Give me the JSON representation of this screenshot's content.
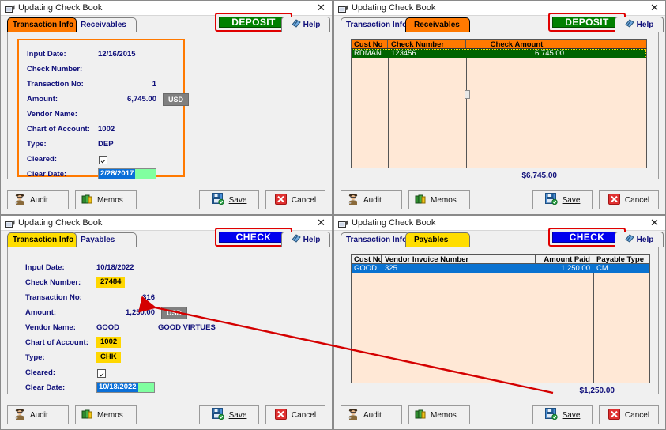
{
  "window_title": "Updating Check Book",
  "common": {
    "tab_transaction": "Transaction Info",
    "help_label": "Help",
    "audit_label": "Audit",
    "memos_label": "Memos",
    "save_label": "Save",
    "cancel_label": "Cancel",
    "close_glyph": "✕",
    "usd_chip": "USD"
  },
  "labels": {
    "input_date": "Input Date:",
    "check_number": "Check Number:",
    "transaction_no": "Transaction No:",
    "amount": "Amount:",
    "vendor_name": "Vendor Name:",
    "chart_of_account": "Chart of Account:",
    "type": "Type:",
    "cleared": "Cleared:",
    "clear_date": "Clear Date:"
  },
  "panels": {
    "top_left": {
      "tab_second": "Receivables",
      "active_tab": "Transaction Info",
      "action_button": "DEPOSIT",
      "action_color": "#008000",
      "form": {
        "input_date": "12/16/2015",
        "check_number": "",
        "transaction_no": "1",
        "amount": "6,745.00",
        "vendor_name": "",
        "chart_of_account": "1002",
        "type": "DEP",
        "cleared": true,
        "clear_date": "2/28/2017"
      }
    },
    "top_right": {
      "tab_second": "Receivables",
      "active_tab": "Receivables",
      "action_button": "DEPOSIT",
      "action_color": "#008000",
      "grid": {
        "columns": [
          "Cust No",
          "Check Number",
          "Check Amount"
        ],
        "rows": [
          {
            "cust_no": "RDMAN",
            "check_number": "123456",
            "check_amount": "6,745.00"
          }
        ],
        "total": "$6,745.00"
      }
    },
    "bottom_left": {
      "tab_second": "Payables",
      "active_tab": "Transaction Info",
      "action_button": "CHECK",
      "action_color": "#0000ee",
      "form": {
        "input_date": "10/18/2022",
        "check_number": "27484",
        "transaction_no": "316",
        "amount": "1,250.00",
        "vendor_name": "GOOD",
        "vendor_full_name": "GOOD VIRTUES",
        "chart_of_account": "1002",
        "type": "CHK",
        "cleared": true,
        "clear_date": "10/18/2022"
      }
    },
    "bottom_right": {
      "tab_second": "Payables",
      "active_tab": "Payables",
      "action_button": "CHECK",
      "action_color": "#0000ee",
      "grid": {
        "columns": [
          "Cust No",
          "Vendor Invoice Number",
          "Amount Paid",
          "Payable Type"
        ],
        "rows": [
          {
            "cust_no": "GOOD",
            "invoice_number": "325",
            "amount_paid": "1,250.00",
            "payable_type": "CM"
          }
        ],
        "total": "$1,250.00"
      }
    }
  },
  "annotations": {
    "arrow_color": "#d40000",
    "highlight_color": "#e00000"
  }
}
